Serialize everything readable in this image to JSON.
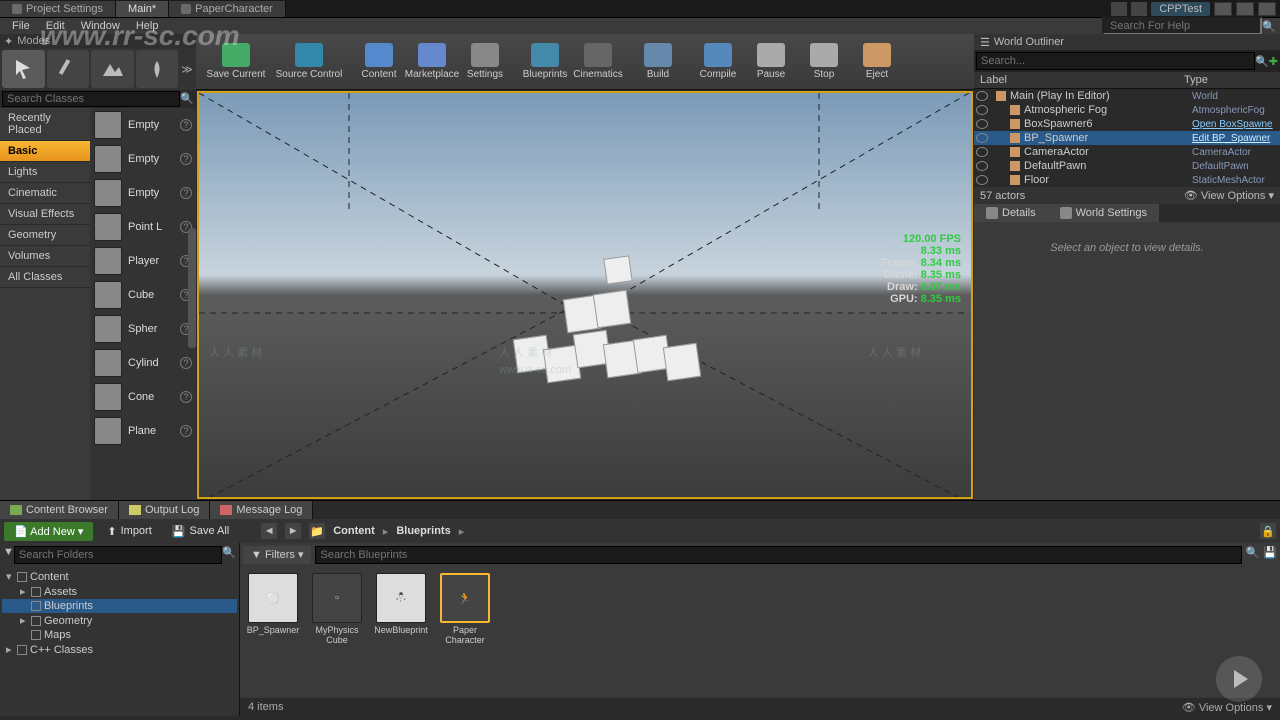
{
  "tabs": [
    {
      "label": "Project Settings"
    },
    {
      "label": "Main*"
    },
    {
      "label": "PaperCharacter"
    }
  ],
  "cpp_label": "CPPTest",
  "menu": {
    "file": "File",
    "edit": "Edit",
    "window": "Window",
    "help": "Help",
    "search_help": "Search For Help"
  },
  "modes": {
    "title": "Modes",
    "search_placeholder": "Search Classes"
  },
  "categories": {
    "recently": "Recently Placed",
    "basic": "Basic",
    "lights": "Lights",
    "cinematic": "Cinematic",
    "vfx": "Visual Effects",
    "geometry": "Geometry",
    "volumes": "Volumes",
    "all": "All Classes"
  },
  "placers": [
    {
      "label": "Empty"
    },
    {
      "label": "Empty"
    },
    {
      "label": "Empty"
    },
    {
      "label": "Point L"
    },
    {
      "label": "Player"
    },
    {
      "label": "Cube"
    },
    {
      "label": "Spher"
    },
    {
      "label": "Cylind"
    },
    {
      "label": "Cone"
    },
    {
      "label": "Plane"
    }
  ],
  "toolbar": {
    "save": "Save Current",
    "source": "Source Control",
    "content": "Content",
    "marketplace": "Marketplace",
    "settings": "Settings",
    "blueprints": "Blueprints",
    "cinematics": "Cinematics",
    "build": "Build",
    "compile": "Compile",
    "pause": "Pause",
    "stop": "Stop",
    "eject": "Eject"
  },
  "stats": {
    "fps": "120.00 FPS",
    "ms": "8.33 ms",
    "frame_l": "Frame:",
    "frame_v": "8.34 ms",
    "game_l": "Game:",
    "game_v": "8.35 ms",
    "draw_l": "Draw:",
    "draw_v": "6.07 ms",
    "gpu_l": "GPU:",
    "gpu_v": "8.35 ms"
  },
  "outliner": {
    "title": "World Outliner",
    "search": "Search...",
    "label": "Label",
    "type": "Type",
    "rows": [
      {
        "name": "Main (Play In Editor)",
        "type": "World",
        "indent": 0
      },
      {
        "name": "Atmospheric Fog",
        "type": "AtmosphericFog",
        "indent": 1
      },
      {
        "name": "BoxSpawner6",
        "type": "Open BoxSpawne",
        "indent": 1,
        "link": true
      },
      {
        "name": "BP_Spawner",
        "type": "Edit BP_Spawner",
        "indent": 1,
        "sel": true,
        "link": true
      },
      {
        "name": "CameraActor",
        "type": "CameraActor",
        "indent": 1
      },
      {
        "name": "DefaultPawn",
        "type": "DefaultPawn",
        "indent": 1
      },
      {
        "name": "Floor",
        "type": "StaticMeshActor",
        "indent": 1
      }
    ],
    "count": "57 actors",
    "view": "View Options"
  },
  "details": {
    "tab1": "Details",
    "tab2": "World Settings",
    "empty": "Select an object to view details."
  },
  "bottom_tabs": {
    "cb": "Content Browser",
    "log": "Output Log",
    "msg": "Message Log"
  },
  "cb": {
    "add": "Add New",
    "import": "Import",
    "saveall": "Save All",
    "crumb1": "Content",
    "crumb2": "Blueprints",
    "search_folders": "Search Folders",
    "filters": "Filters",
    "search_bp": "Search Blueprints",
    "tree": {
      "content": "Content",
      "assets": "Assets",
      "blueprints": "Blueprints",
      "geometry": "Geometry",
      "maps": "Maps",
      "cpp": "C++ Classes"
    },
    "assets": [
      {
        "name": "BP_Spawner"
      },
      {
        "name": "MyPhysics Cube"
      },
      {
        "name": "NewBlueprint"
      },
      {
        "name": "Paper Character"
      }
    ],
    "count": "4 items",
    "view": "View Options"
  },
  "watermark": {
    "cn": "人 人 素 材",
    "url": "www.rr-sc.com"
  }
}
